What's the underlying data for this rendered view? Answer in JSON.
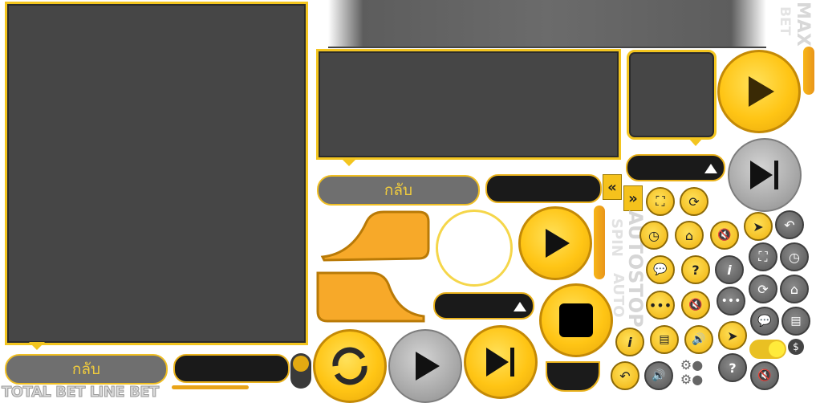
{
  "buttons": {
    "back_label_top": "กลับ",
    "back_label_bottom": "กลับ"
  },
  "labels": {
    "max": "MAX",
    "bet": "BET",
    "autostop": "AUTOSTOP",
    "auto": "AUTO",
    "spin": "SPIN",
    "bottom_bar": "TOTAL BET LINE BET",
    "currency": "$"
  },
  "colors": {
    "gold": "#f3c51f",
    "panel": "#464646",
    "dark": "#1a1a1a",
    "grey": "#6f6f6f"
  },
  "icons": {
    "play": "play-icon",
    "skip": "skip-next-icon",
    "stop": "stop-icon",
    "refresh": "refresh-icon",
    "fullscreen": "fullscreen-icon",
    "history": "history-icon",
    "home": "home-icon",
    "mute": "mute-icon",
    "sound": "sound-icon",
    "info": "info-icon",
    "help": "help-icon",
    "chat": "chat-icon",
    "more": "more-icon",
    "paytable": "paytable-icon",
    "undo": "undo-icon",
    "cursor": "cursor-arrow-icon",
    "rewind": "rewind-icon",
    "fastforward": "fastforward-icon"
  }
}
